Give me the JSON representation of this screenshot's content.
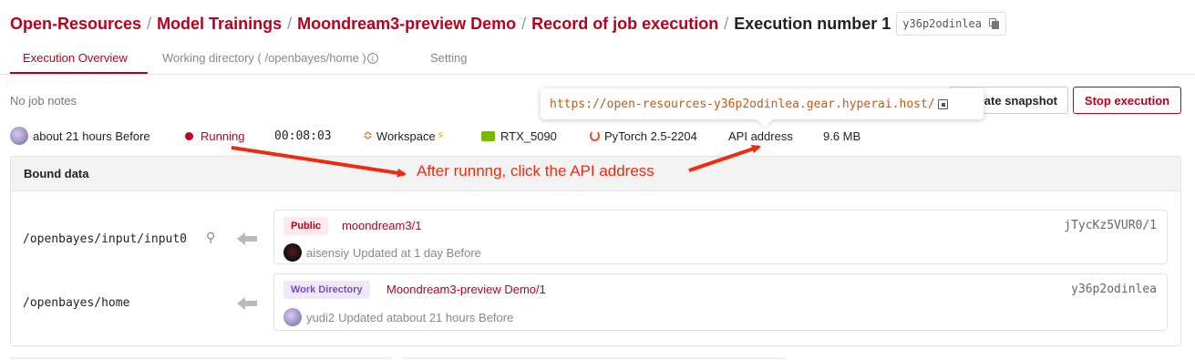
{
  "breadcrumb": {
    "items": [
      "Open-Resources",
      "Model Trainings",
      "Moondream3-preview Demo",
      "Record of job execution"
    ],
    "separator": "/",
    "current": "Execution number 1",
    "job_id": "y36p2odinlea"
  },
  "tabs": [
    {
      "label": "Execution Overview",
      "active": true
    },
    {
      "label": "Working directory ( /openbayes/home )",
      "active": false
    },
    {
      "label": "Setting",
      "active": false
    }
  ],
  "notes": "No job notes",
  "actions": {
    "snapshot_label": "Create snapshot",
    "stop_label": "Stop execution"
  },
  "tooltip": {
    "url": "https://open-resources-y36p2odinlea.gear.hyperai.host/"
  },
  "meta": {
    "time": "about 21 hours Before",
    "status": "Running",
    "duration": "00:08:03",
    "environment": "Workspace",
    "gpu": "RTX_5090",
    "framework": "PyTorch 2.5-2204",
    "api_address": "API address",
    "size": "9.6 MB"
  },
  "annotation": {
    "text": "After runnng, click the API address",
    "color": "#ee2a10"
  },
  "bound_data": {
    "title": "Bound data",
    "mounts": [
      {
        "path": "/openbayes/input/input0",
        "tag": "Public",
        "name": "moondream3/1",
        "id": "jTycKz5VUR0/1",
        "user": "aisensiy",
        "updated": "Updated at 1 day Before"
      },
      {
        "path": "/openbayes/home",
        "tag": "Work Directory",
        "name": "Moondream3-preview Demo/1",
        "id": "y36p2odinlea",
        "user": "yudi2",
        "updated": "Updated atabout 21 hours Before"
      }
    ]
  },
  "colors": {
    "brand": "#b8001c",
    "running": "#c0001e",
    "url": "#c05a10"
  }
}
